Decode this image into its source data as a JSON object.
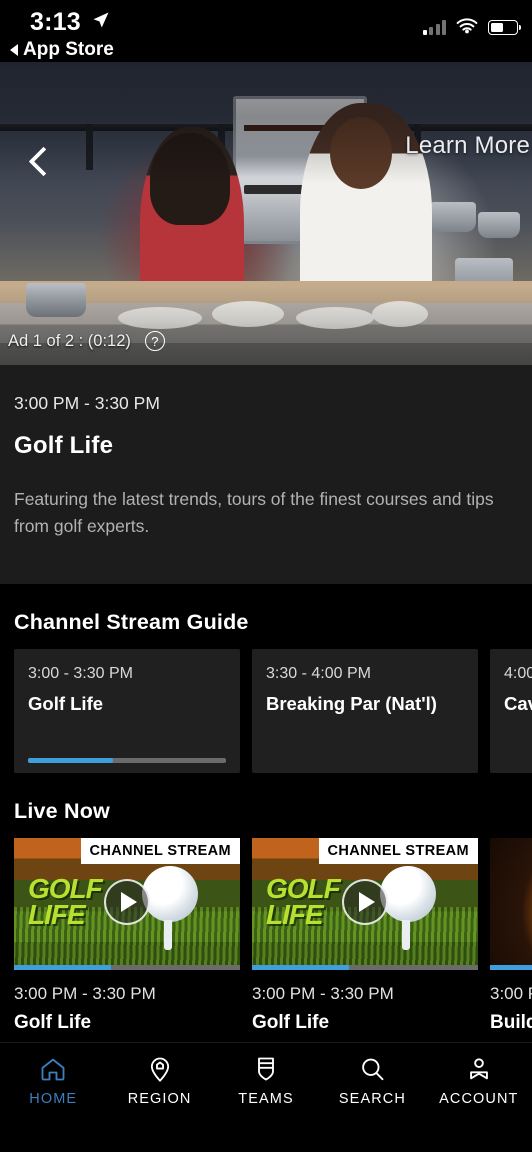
{
  "status_bar": {
    "time": "3:13",
    "location_icon": "location-arrow-icon",
    "return_label": "App Store",
    "cellular_icon": "cellular-signal-icon",
    "wifi_icon": "wifi-icon",
    "battery_icon": "battery-icon",
    "battery_level": 50
  },
  "player": {
    "back_icon": "back-chevron-icon",
    "learn_more_label": "Learn More",
    "ad_status": "Ad 1 of 2 : (0:12)",
    "help_icon": "question-mark-icon",
    "help_glyph": "?"
  },
  "program": {
    "time": "3:00 PM - 3:30 PM",
    "title": "Golf Life",
    "description": "Featuring the latest trends, tours of the finest courses and tips from golf experts."
  },
  "guide": {
    "title": "Channel Stream Guide",
    "cards": [
      {
        "time": "3:00 - 3:30 PM",
        "title": "Golf Life",
        "progress": 43
      },
      {
        "time": "3:30 - 4:00 PM",
        "title": "Breaking Par (Nat'l)",
        "progress": 0
      },
      {
        "time": "4:00",
        "title": "Cav",
        "progress": 0
      }
    ]
  },
  "live_now": {
    "title": "Live Now",
    "cards": [
      {
        "badge": "CHANNEL STREAM",
        "thumb_logo_line1": "GOLF",
        "thumb_logo_line2": "LIFE",
        "play_icon": "play-icon",
        "progress": 43,
        "time": "3:00 PM - 3:30 PM",
        "title": "Golf Life"
      },
      {
        "badge": "CHANNEL STREAM",
        "thumb_logo_line1": "GOLF",
        "thumb_logo_line2": "LIFE",
        "play_icon": "play-icon",
        "progress": 43,
        "time": "3:00 PM - 3:30 PM",
        "title": "Golf Life"
      },
      {
        "badge": "",
        "thumb_logo_line1": "",
        "thumb_logo_line2": "",
        "play_icon": "play-icon",
        "progress": 43,
        "time": "3:00 P",
        "title": "Build"
      }
    ]
  },
  "tab_bar": {
    "active_color": "#3c7fbf",
    "items": [
      {
        "label": "HOME",
        "icon": "home-icon",
        "active": true
      },
      {
        "label": "REGION",
        "icon": "map-pin-icon",
        "active": false
      },
      {
        "label": "TEAMS",
        "icon": "shield-icon",
        "active": false
      },
      {
        "label": "SEARCH",
        "icon": "search-icon",
        "active": false
      },
      {
        "label": "ACCOUNT",
        "icon": "account-icon",
        "active": false
      }
    ]
  },
  "colors": {
    "accent_blue": "#3e9fdc",
    "tab_active": "#3c7fbf",
    "panel": "#1c1c1c",
    "card": "#202020"
  }
}
